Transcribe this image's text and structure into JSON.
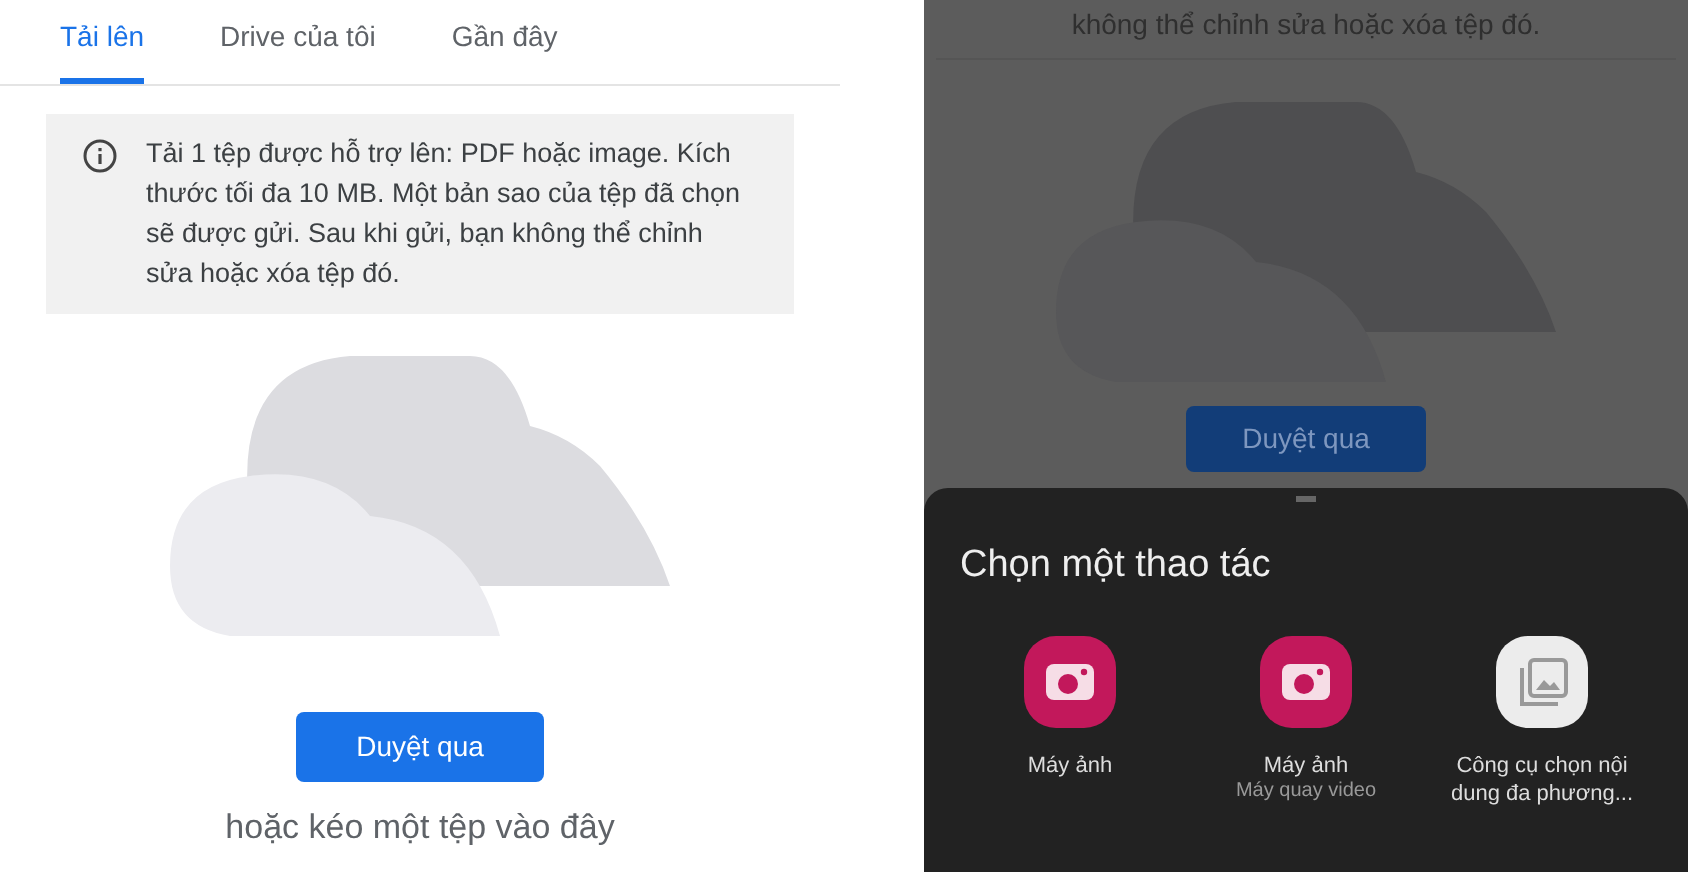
{
  "left": {
    "tabs": [
      {
        "label": "Tải lên",
        "selected": true
      },
      {
        "label": "Drive của tôi",
        "selected": false
      },
      {
        "label": "Gần đây",
        "selected": false
      }
    ],
    "info": "Tải 1 tệp được hỗ trợ lên: PDF hoặc image. Kích thước tối đa 10 MB. Một bản sao của tệp đã chọn sẽ được gửi. Sau khi gửi, bạn không thể chỉnh sửa hoặc xóa tệp đó.",
    "browse_button": "Duyệt qua",
    "drop_hint": "hoặc kéo một tệp vào đây"
  },
  "right": {
    "background": {
      "info_tail": "không thể chỉnh sửa hoặc xóa tệp đó.",
      "browse_button": "Duyệt qua"
    },
    "sheet": {
      "title": "Chọn một thao tác",
      "actions": [
        {
          "kind": "camera",
          "label": "Máy ảnh"
        },
        {
          "kind": "camera",
          "label": "Máy ảnh",
          "sublabel": "Máy quay video"
        },
        {
          "kind": "gallery",
          "label": "Công cụ chọn nội dung đa phương..."
        }
      ]
    }
  }
}
